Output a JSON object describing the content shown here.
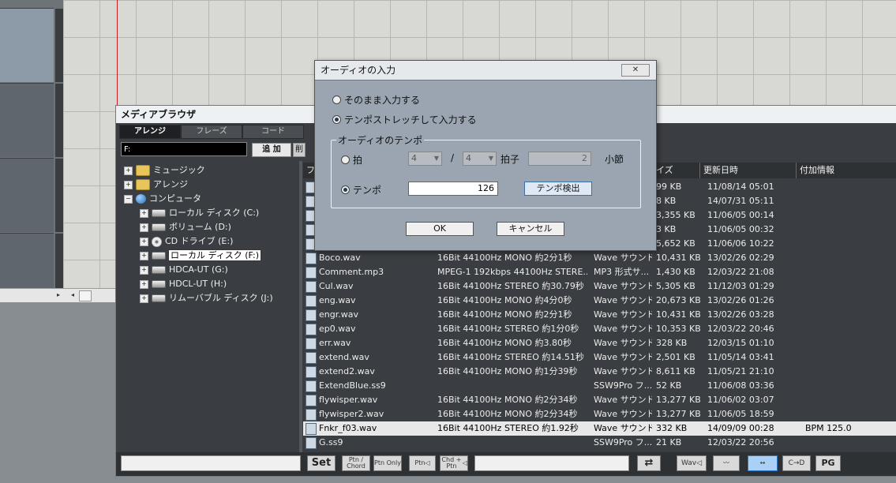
{
  "media_browser": {
    "title": "メディアブラウザ",
    "tabs": [
      "アレンジ",
      "フレーズ",
      "コード"
    ],
    "path": "F:",
    "add_label": "追 加",
    "delete_label": "削",
    "tree": [
      {
        "label": "ミュージック",
        "icon": "folder-icon"
      },
      {
        "label": "アレンジ",
        "icon": "folder-icon"
      },
      {
        "label": "コンピュータ",
        "icon": "computer-icon"
      },
      {
        "label": "ローカル ディスク (C:)",
        "icon": "disk-icon"
      },
      {
        "label": "ボリューム (D:)",
        "icon": "disk-icon"
      },
      {
        "label": "CD ドライブ (E:)",
        "icon": "cd-icon"
      },
      {
        "label": "ローカル ディスク (F:)",
        "icon": "disk-icon"
      },
      {
        "label": "HDCA-UT (G:)",
        "icon": "disk-icon"
      },
      {
        "label": "HDCL-UT (H:)",
        "icon": "disk-icon"
      },
      {
        "label": "リムーバブル ディスク (J:)",
        "icon": "disk-icon"
      }
    ],
    "columns": [
      "ファ",
      "イズ",
      "更新日時",
      "付加情報"
    ],
    "files": [
      {
        "name": "",
        "format": "",
        "type": "",
        "size": "99 KB",
        "date": "11/08/14 05:01",
        "extra": ""
      },
      {
        "name": "",
        "format": "",
        "type": "",
        "size": "8 KB",
        "date": "14/07/31 05:11",
        "extra": ""
      },
      {
        "name": "",
        "format": "",
        "type": "",
        "size": "3,355 KB",
        "date": "11/06/05 00:14",
        "extra": ""
      },
      {
        "name": "",
        "format": "",
        "type": "",
        "size": "3 KB",
        "date": "11/06/05 00:32",
        "extra": ""
      },
      {
        "name": "",
        "format": "",
        "type": "",
        "size": "5,652 KB",
        "date": "11/06/06 10:22",
        "extra": ""
      },
      {
        "name": "Boco.wav",
        "format": "16Bit 44100Hz MONO 約2分1秒",
        "type": "Wave サウンド",
        "size": "10,431 KB",
        "date": "13/02/26 02:29",
        "extra": ""
      },
      {
        "name": "Comment.mp3",
        "format": "MPEG-1 192kbps 44100Hz STERE...",
        "type": "MP3 形式サ...",
        "size": "1,430 KB",
        "date": "12/03/22 21:08",
        "extra": ""
      },
      {
        "name": "Cul.wav",
        "format": "16Bit 44100Hz STEREO 約30.79秒",
        "type": "Wave サウンド",
        "size": "5,305 KB",
        "date": "11/12/03 01:29",
        "extra": ""
      },
      {
        "name": "eng.wav",
        "format": "16Bit 44100Hz MONO 約4分0秒",
        "type": "Wave サウンド",
        "size": "20,673 KB",
        "date": "13/02/26 01:26",
        "extra": ""
      },
      {
        "name": "engr.wav",
        "format": "16Bit 44100Hz MONO 約2分1秒",
        "type": "Wave サウンド",
        "size": "10,431 KB",
        "date": "13/02/26 03:28",
        "extra": ""
      },
      {
        "name": "ep0.wav",
        "format": "16Bit 44100Hz STEREO 約1分0秒",
        "type": "Wave サウンド",
        "size": "10,353 KB",
        "date": "12/03/22 20:46",
        "extra": ""
      },
      {
        "name": "err.wav",
        "format": "16Bit 44100Hz MONO 約3.80秒",
        "type": "Wave サウンド",
        "size": "328 KB",
        "date": "12/03/15 01:10",
        "extra": ""
      },
      {
        "name": "extend.wav",
        "format": "16Bit 44100Hz STEREO 約14.51秒",
        "type": "Wave サウンド",
        "size": "2,501 KB",
        "date": "11/05/14 03:41",
        "extra": ""
      },
      {
        "name": "extend2.wav",
        "format": "16Bit 44100Hz MONO 約1分39秒",
        "type": "Wave サウンド",
        "size": "8,611 KB",
        "date": "11/05/21 21:10",
        "extra": ""
      },
      {
        "name": "ExtendBlue.ss9",
        "format": "",
        "type": "SSW9Pro フ...",
        "size": "52 KB",
        "date": "11/06/08 03:36",
        "extra": ""
      },
      {
        "name": "flywisper.wav",
        "format": "16Bit 44100Hz MONO 約2分34秒",
        "type": "Wave サウンド",
        "size": "13,277 KB",
        "date": "11/06/02 03:07",
        "extra": ""
      },
      {
        "name": "flywisper2.wav",
        "format": "16Bit 44100Hz MONO 約2分34秒",
        "type": "Wave サウンド",
        "size": "13,277 KB",
        "date": "11/06/05 18:59",
        "extra": ""
      },
      {
        "name": "Fnkr_f03.wav",
        "format": "16Bit 44100Hz STEREO 約1.92秒",
        "type": "Wave サウンド",
        "size": "332 KB",
        "date": "14/09/09 00:28",
        "extra": "BPM 125.0"
      },
      {
        "name": "G.ss9",
        "format": "",
        "type": "SSW9Pro フ...",
        "size": "21 KB",
        "date": "12/03/22 20:56",
        "extra": ""
      }
    ],
    "selected_file_index": 17,
    "toolbar": {
      "set_label": "Set",
      "ptn_chord": "Ptn / Chord",
      "ptn_only": "Ptn Only",
      "ptn_speaker": "Ptn",
      "chd_ptn": "Chd + Ptn",
      "wav": "Wav",
      "cd": "C→D",
      "pg": "PG"
    }
  },
  "dialog": {
    "title": "オーディオの入力",
    "close_label": "✕",
    "option_as_is": "そのまま入力する",
    "option_stretch": "テンポストレッチして入力する",
    "selected_option": "stretch",
    "group_label": "オーディオのテンポ",
    "beat_label": "拍",
    "beat_num": "4",
    "beat_den": "4",
    "slash": "/",
    "beats_suffix": "拍子",
    "measures_value": "2",
    "measures_suffix": "小節",
    "tempo_label": "テンポ",
    "tempo_value": "126",
    "detect_label": "テンポ検出",
    "tempo_mode": "tempo",
    "ok_label": "OK",
    "cancel_label": "キャンセル"
  }
}
